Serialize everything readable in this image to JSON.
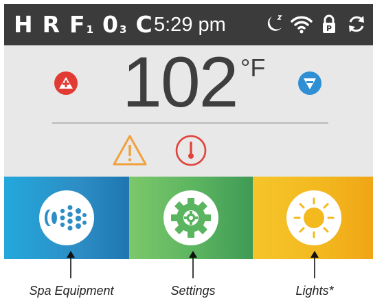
{
  "status_bar": {
    "codes": [
      {
        "main": "H",
        "sub": ""
      },
      {
        "main": "R",
        "sub": ""
      },
      {
        "main": "F",
        "sub": "1"
      },
      {
        "main": "0",
        "sub": "3"
      },
      {
        "main": "C",
        "sub": ""
      }
    ],
    "time": "5:29 pm",
    "icons": [
      "sleep-moon-icon",
      "wifi-icon",
      "lock-p-icon",
      "refresh-icon"
    ]
  },
  "temperature": {
    "value": "102",
    "unit": "°F",
    "increase_icon": "plus-icon",
    "decrease_icon": "triangle-down-icon",
    "alerts": [
      "warning-triangle-icon",
      "thermometer-icon"
    ]
  },
  "tiles": [
    {
      "id": "spa-equipment",
      "icon": "jets-icon",
      "caption": "Spa Equipment",
      "color": "#2d8dc4"
    },
    {
      "id": "settings",
      "icon": "gear-icon",
      "caption": "Settings",
      "color": "#5bb460"
    },
    {
      "id": "lights",
      "icon": "sun-icon",
      "caption": "Lights*",
      "color": "#f3b91f"
    }
  ],
  "colors": {
    "status_bar": "#3b3b3b",
    "increase": "#e23b34",
    "decrease": "#2f8fd4",
    "warning": "#f0a13a",
    "thermometer": "#e0433a"
  }
}
